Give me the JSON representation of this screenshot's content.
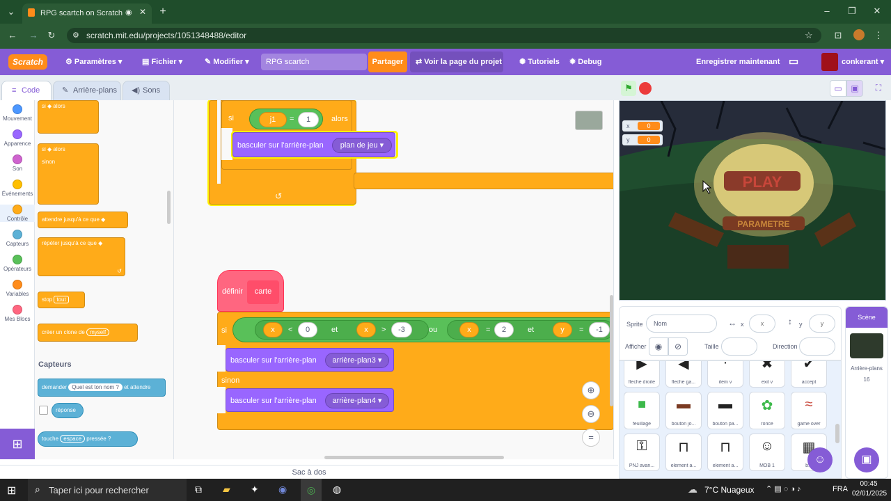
{
  "browser": {
    "tab_title": "RPG scartch on Scratch",
    "new_tab": "+",
    "url": "scratch.mit.edu/projects/1051348488/editor"
  },
  "menu": {
    "logo": "Scratch",
    "settings": "Paramètres",
    "file": "Fichier",
    "edit": "Modifier",
    "project_title": "RPG scartch",
    "share": "Partager",
    "see_project": "Voir la page du projet",
    "tutorials": "Tutoriels",
    "debug": "Debug",
    "save_now": "Enregistrer maintenant",
    "username": "conkerant"
  },
  "editor_tabs": {
    "code": "Code",
    "backdrops": "Arrière-plans",
    "sounds": "Sons"
  },
  "categories": [
    {
      "label": "Mouvement",
      "color": "#4c97ff"
    },
    {
      "label": "Apparence",
      "color": "#9966ff"
    },
    {
      "label": "Son",
      "color": "#cf63cf"
    },
    {
      "label": "Événements",
      "color": "#ffbf00"
    },
    {
      "label": "Contrôle",
      "color": "#ffab19"
    },
    {
      "label": "Capteurs",
      "color": "#5cb1d6"
    },
    {
      "label": "Opérateurs",
      "color": "#59c059"
    },
    {
      "label": "Variables",
      "color": "#ff8c1a"
    },
    {
      "label": "Mes Blocs",
      "color": "#ff6680"
    }
  ],
  "palette": {
    "if_then": "si",
    "then": "alors",
    "else": "sinon",
    "wait_until": "attendre jusqu'à ce que",
    "repeat_until": "répéter jusqu'à ce que",
    "stop": "stop",
    "stop_value": "tout",
    "create_clone": "créer un clone de",
    "clone_value": "myself",
    "sensing_heading": "Capteurs",
    "ask": "demander",
    "ask_value": "Quel est ton nom ?",
    "and_wait": "et attendre",
    "answer": "réponse",
    "key": "touche",
    "key_value": "espace",
    "pressed": "pressée ?"
  },
  "script1": {
    "if": "si",
    "var": "j1",
    "eq": "=",
    "val": "1",
    "then": "alors",
    "switch_label": "basculer sur l'arrière-plan",
    "backdrop": "plan de jeu"
  },
  "script2": {
    "define": "définir",
    "block_name": "carte",
    "if": "si",
    "x1": "x",
    "op1": "<",
    "v1": "0",
    "and1": "et",
    "x2": "x",
    "op2": ">",
    "v2": "-3",
    "or": "ou",
    "x3": "x",
    "op3": "=",
    "v3": "2",
    "and2": "et",
    "y4": "y",
    "op4": "=",
    "v4": "-1",
    "switch1": "basculer sur l'arrière-plan",
    "backdrop1": "arrière-plan3",
    "else": "sinon",
    "switch2": "basculer sur l'arrière-plan",
    "backdrop2": "arrière-plan4"
  },
  "backpack": "Sac à dos",
  "stage": {
    "x_label": "x",
    "x_value": "0",
    "y_label": "y",
    "y_value": "0",
    "play_text": "PLAY",
    "param_text": "PARAMETRE"
  },
  "sprite_info": {
    "sprite_label": "Sprite",
    "sprite_name": "Nom",
    "x_label": "x",
    "x_placeholder": "x",
    "y_label": "y",
    "y_placeholder": "y",
    "show_label": "Afficher",
    "size_label": "Taille",
    "direction_label": "Direction"
  },
  "sprites": [
    {
      "name": "fleche droite",
      "icon": "▶"
    },
    {
      "name": "fleche ga...",
      "icon": "◀"
    },
    {
      "name": "item v",
      "icon": "·"
    },
    {
      "name": "exit v",
      "icon": "✖"
    },
    {
      "name": "accept",
      "icon": "✔"
    },
    {
      "name": "feuillage",
      "icon": "■"
    },
    {
      "name": "bouton jo...",
      "icon": "▬"
    },
    {
      "name": "bouton pa...",
      "icon": "▬"
    },
    {
      "name": "ronce",
      "icon": "✿"
    },
    {
      "name": "game over",
      "icon": "≈"
    },
    {
      "name": "PNJ avan...",
      "icon": "⚿"
    },
    {
      "name": "element a...",
      "icon": "⊓"
    },
    {
      "name": "element a...",
      "icon": "⊓"
    },
    {
      "name": "MOB 1",
      "icon": "☺"
    },
    {
      "name": "b...",
      "icon": "▦"
    }
  ],
  "scene": {
    "title": "Scène",
    "backdrops_label": "Arrière-plans",
    "backdrops_count": "16"
  },
  "taskbar": {
    "search": "Taper ici pour rechercher",
    "weather": "7°C Nuageux",
    "lang": "FRA",
    "time": "00:45",
    "date": "02/01/2025"
  }
}
